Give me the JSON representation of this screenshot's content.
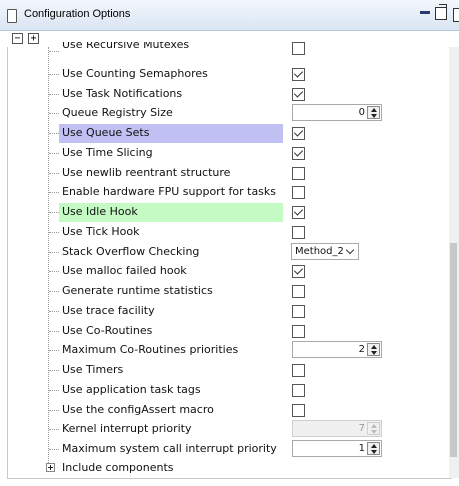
{
  "window": {
    "title": "Configuration Options",
    "minimize_icon": "minimize-icon",
    "restore_icon": "restore-icon",
    "maximize_icon": "maximize-icon"
  },
  "toolbar": {
    "collapse_label": "−",
    "expand_label": "+"
  },
  "options": [
    {
      "label": "Use Recursive Mutexes",
      "type": "checkbox",
      "checked": false,
      "partial": true
    },
    {
      "label": "Use Counting Semaphores",
      "type": "checkbox",
      "checked": true
    },
    {
      "label": "Use Task Notifications",
      "type": "checkbox",
      "checked": true
    },
    {
      "label": "Queue Registry Size",
      "type": "spinner",
      "value": "0"
    },
    {
      "label": "Use Queue Sets",
      "type": "checkbox",
      "checked": true,
      "highlight": "#c0c0f2"
    },
    {
      "label": "Use Time Slicing",
      "type": "checkbox",
      "checked": true
    },
    {
      "label": "Use newlib reentrant structure",
      "type": "checkbox",
      "checked": false
    },
    {
      "label": "Enable hardware FPU support for tasks",
      "type": "checkbox",
      "checked": false
    },
    {
      "label": "Use Idle Hook",
      "type": "checkbox",
      "checked": true,
      "highlight": "#c4fac4"
    },
    {
      "label": "Use Tick Hook",
      "type": "checkbox",
      "checked": false
    },
    {
      "label": "Stack Overflow Checking",
      "type": "combo",
      "value": "Method_2"
    },
    {
      "label": "Use malloc failed hook",
      "type": "checkbox",
      "checked": true
    },
    {
      "label": "Generate runtime statistics",
      "type": "checkbox",
      "checked": false
    },
    {
      "label": "Use trace facility",
      "type": "checkbox",
      "checked": false
    },
    {
      "label": "Use Co-Routines",
      "type": "checkbox",
      "checked": false
    },
    {
      "label": "Maximum Co-Routines priorities",
      "type": "spinner",
      "value": "2"
    },
    {
      "label": "Use Timers",
      "type": "checkbox",
      "checked": false
    },
    {
      "label": "Use application task tags",
      "type": "checkbox",
      "checked": false
    },
    {
      "label": "Use the configAssert macro",
      "type": "checkbox",
      "checked": false
    },
    {
      "label": "Kernel interrupt priority",
      "type": "spinner",
      "value": "7",
      "disabled": true
    },
    {
      "label": "Maximum system call interrupt priority",
      "type": "spinner",
      "value": "1"
    }
  ],
  "footer_node": {
    "label": "Include components"
  }
}
